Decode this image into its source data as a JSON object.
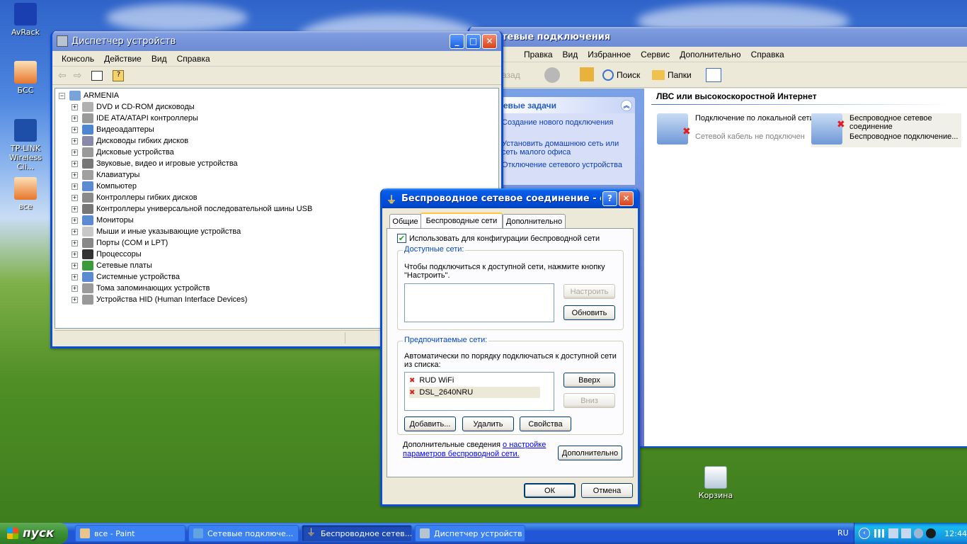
{
  "desktop": {
    "icons": [
      {
        "label": "AvRack"
      },
      {
        "label": "БСС"
      },
      {
        "label": "TP-LINK Wireless Cli..."
      },
      {
        "label": "все"
      },
      {
        "label": "Корзина"
      }
    ]
  },
  "device_manager": {
    "title": "Диспетчер устройств",
    "menu": [
      "Консоль",
      "Действие",
      "Вид",
      "Справка"
    ],
    "root": "ARMENIA",
    "items": [
      "DVD и CD-ROM дисководы",
      "IDE ATA/ATAPI контроллеры",
      "Видеоадаптеры",
      "Дисководы гибких дисков",
      "Дисковые устройства",
      "Звуковые, видео и игровые устройства",
      "Клавиатуры",
      "Компьютер",
      "Контроллеры гибких дисков",
      "Контроллеры универсальной последовательной шины USB",
      "Мониторы",
      "Мыши и иные указывающие устройства",
      "Порты (COM и LPT)",
      "Процессоры",
      "Сетевые платы",
      "Системные устройства",
      "Тома запоминающих устройств",
      "Устройства HID (Human Interface Devices)"
    ]
  },
  "network_connections": {
    "title": "тевые подключения",
    "menu": [
      "Правка",
      "Вид",
      "Избранное",
      "Сервис",
      "Дополнительно",
      "Справка"
    ],
    "toolbar": {
      "back": "азад",
      "search": "Поиск",
      "folders": "Папки"
    },
    "section_header": "ЛВС или высокоскоростной Интернет",
    "tasks_title": "тевые задачи",
    "tasks": [
      "Создание нового подключения",
      "Установить домашнюю сеть или сеть малого офиса",
      "Отключение сетевого устройства"
    ],
    "connections": [
      {
        "name": "Подключение по локальной сети",
        "status": "Сетевой кабель не подключен"
      },
      {
        "name": "Беспроводное сетевое соединение",
        "status": "Беспроводное подключение..."
      }
    ]
  },
  "dialog": {
    "title": "Беспроводное сетевое соединение - свой...",
    "tabs": [
      "Общие",
      "Беспроводные сети",
      "Дополнительно"
    ],
    "use_windows_checkbox": "Использовать для конфигурации беспроводной сети",
    "available": {
      "label": "Доступные сети:",
      "text": "Чтобы подключиться к доступной сети, нажмите кнопку \"Настроить\".",
      "configure": "Настроить",
      "refresh": "Обновить"
    },
    "preferred": {
      "label": "Предпочитаемые сети:",
      "text": "Автоматически по порядку подключаться к доступной сети из списка:",
      "networks": [
        "RUD WiFi",
        "DSL_2640NRU"
      ],
      "up": "Вверх",
      "down": "Вниз",
      "add": "Добавить...",
      "remove": "Удалить",
      "properties": "Свойства"
    },
    "more_info_prefix": "Дополнительные сведения",
    "more_info_link": "о настройке параметров беспроводной сети.",
    "advanced": "Дополнительно",
    "ok": "ОК",
    "cancel": "Отмена"
  },
  "taskbar": {
    "start": "пуск",
    "tasks": [
      "все - Paint",
      "Сетевые подключе...",
      "Беспроводное сетев...",
      "Диспетчер устройств"
    ],
    "lang": "RU",
    "clock": "12:44"
  }
}
